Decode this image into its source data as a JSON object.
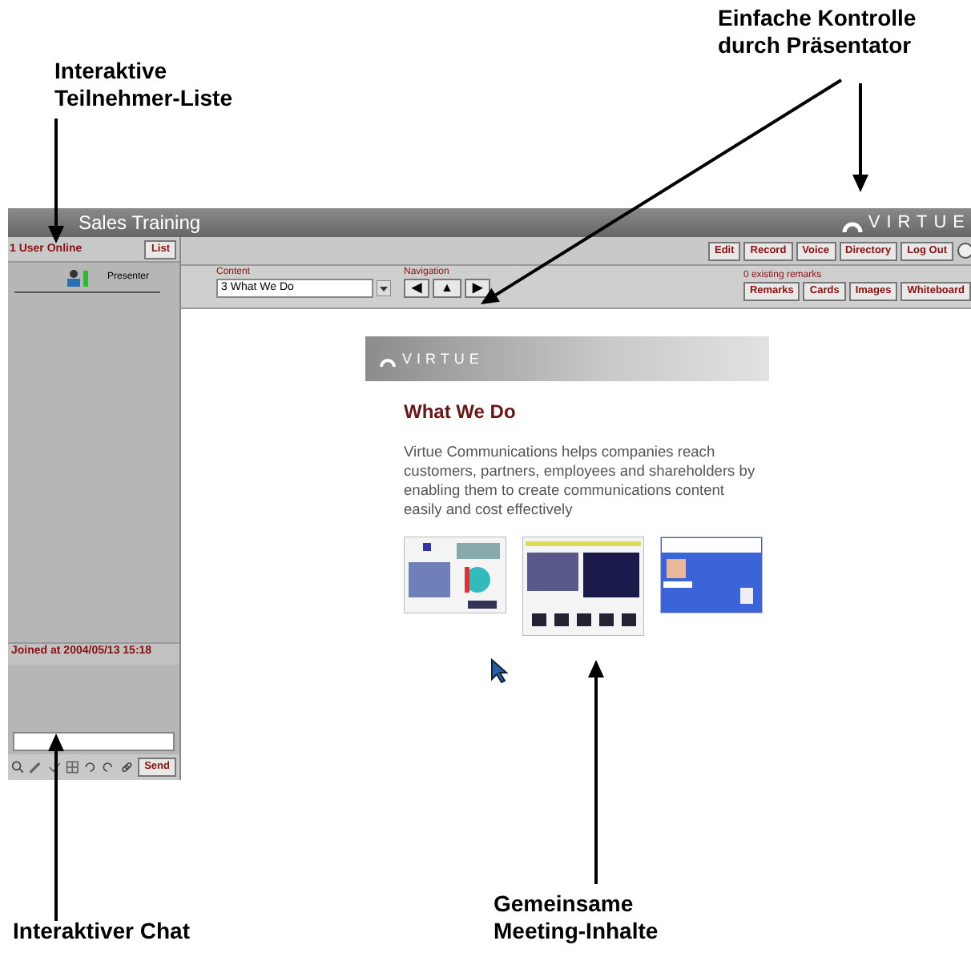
{
  "callouts": {
    "participant_list": "Interaktive Teilnehmer-Liste",
    "presenter_control": "Einfache Kontrolle durch Präsentator",
    "chat": "Interaktiver Chat",
    "shared_content": "Gemeinsame Meeting-Inhalte"
  },
  "window": {
    "title": "Sales Training",
    "logo": "VIRTUE"
  },
  "participants": {
    "header": "1 User Online",
    "list_button": "List",
    "users": [
      {
        "role": "Presenter"
      }
    ],
    "joined": "Joined at 2004/05/13 15:18"
  },
  "chat": {
    "send_button": "Send"
  },
  "toolbar": {
    "buttons": [
      "Edit",
      "Record",
      "Voice",
      "Directory",
      "Log Out"
    ]
  },
  "content": {
    "label": "Content",
    "selected": "3 What We Do"
  },
  "navigation": {
    "label": "Navigation",
    "buttons": [
      "◀",
      "▲",
      "▶"
    ]
  },
  "remarks": {
    "label": "0 existing remarks",
    "buttons": [
      "Remarks",
      "Cards",
      "Images",
      "Whiteboard"
    ]
  },
  "slide": {
    "logo": "VIRTUE",
    "title": "What We Do",
    "text": "Virtue Communications helps companies reach customers, partners, employees and shareholders by enabling them to create communications content easily and cost effectively"
  }
}
